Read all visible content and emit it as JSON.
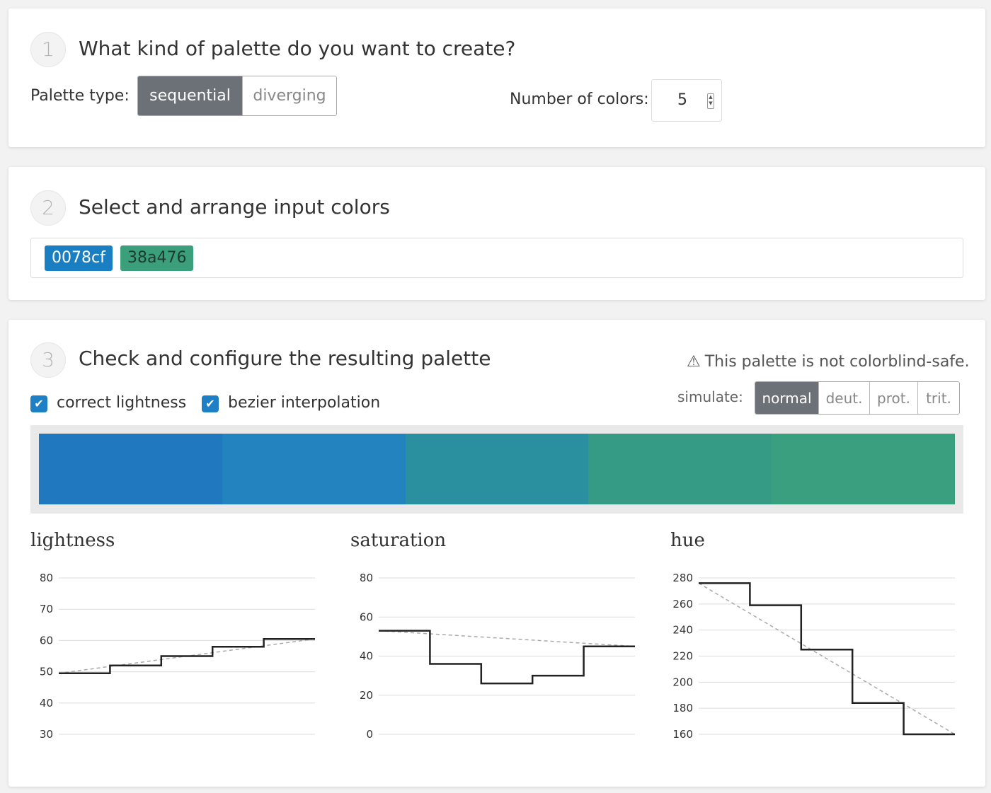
{
  "step1": {
    "number": "1",
    "title": "What kind of palette do you want to create?",
    "palette_type_label": "Palette type:",
    "palette_types": [
      {
        "label": "sequential",
        "active": true
      },
      {
        "label": "diverging",
        "active": false
      }
    ],
    "num_colors_label": "Number of colors:",
    "num_colors_value": "5"
  },
  "step2": {
    "number": "2",
    "title": "Select and arrange input colors",
    "colors": [
      {
        "hex": "0078cf",
        "color": "#1a7fc2"
      },
      {
        "hex": "38a476",
        "color": "#3a9f7a"
      }
    ]
  },
  "step3": {
    "number": "3",
    "title": "Check and configure the resulting palette",
    "warning": "This palette is not colorblind-safe.",
    "options": [
      {
        "label": "correct lightness",
        "checked": true
      },
      {
        "label": "bezier interpolation",
        "checked": true
      }
    ],
    "simulate_label": "simulate:",
    "simulate_modes": [
      {
        "label": "normal",
        "active": true
      },
      {
        "label": "deut.",
        "active": false
      },
      {
        "label": "prot.",
        "active": false
      },
      {
        "label": "trit.",
        "active": false
      }
    ],
    "swatches": [
      "#2079bf",
      "#2383be",
      "#2a8f9f",
      "#369b85",
      "#3a9f7f"
    ]
  },
  "chart_data": [
    {
      "type": "line",
      "title": "lightness",
      "x": [
        0,
        1,
        2,
        3,
        4
      ],
      "series": [
        {
          "values": [
            49.5,
            52,
            55,
            58,
            60.5
          ],
          "style": "step"
        },
        {
          "values": [
            49.5,
            60.5
          ],
          "x": [
            0,
            5
          ],
          "style": "dashed"
        }
      ],
      "yticks": [
        80,
        70,
        60,
        50,
        40,
        30
      ],
      "ylim": [
        30,
        80
      ],
      "grid": true
    },
    {
      "type": "line",
      "title": "saturation",
      "x": [
        0,
        1,
        2,
        3,
        4
      ],
      "series": [
        {
          "values": [
            53,
            36,
            26,
            30,
            45
          ],
          "style": "step"
        },
        {
          "values": [
            53,
            45
          ],
          "x": [
            0,
            5
          ],
          "style": "dashed"
        }
      ],
      "yticks": [
        80,
        60,
        40,
        20,
        0
      ],
      "ylim": [
        0,
        80
      ],
      "grid": true
    },
    {
      "type": "line",
      "title": "hue",
      "x": [
        0,
        1,
        2,
        3,
        4
      ],
      "series": [
        {
          "values": [
            276,
            259,
            225,
            184,
            160
          ],
          "style": "step"
        },
        {
          "values": [
            276,
            160
          ],
          "x": [
            0,
            5
          ],
          "style": "dashed"
        }
      ],
      "yticks": [
        280,
        260,
        240,
        220,
        200,
        180,
        160
      ],
      "ylim": [
        160,
        280
      ],
      "grid": true
    }
  ]
}
